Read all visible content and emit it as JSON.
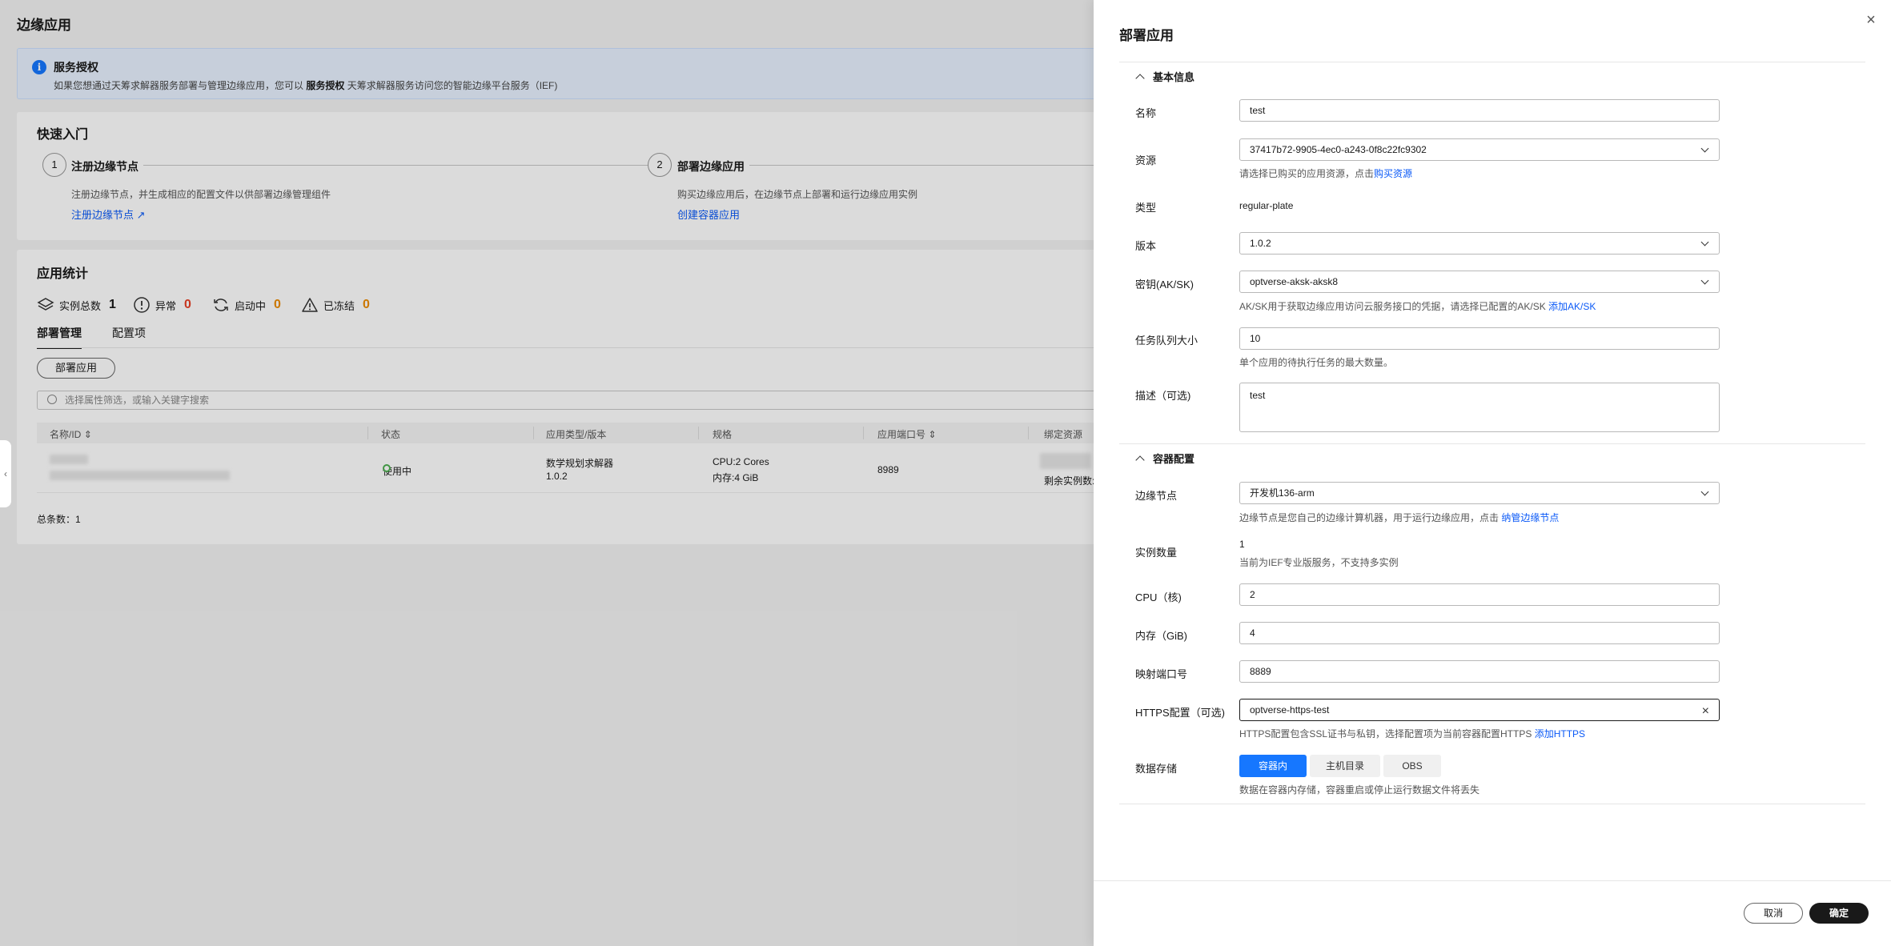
{
  "page": {
    "title": "边缘应用",
    "auth": {
      "title": "服务授权",
      "desc_pre": "如果您想通过天筹求解器服务部署与管理边缘应用，您可以",
      "desc_bold": "服务授权",
      "desc_post": "天筹求解器服务访问您的智能边缘平台服务（IEF)"
    },
    "quick": {
      "title": "快速入门",
      "steps": [
        {
          "num": "1",
          "title": "注册边缘节点",
          "desc": "注册边缘节点，并生成相应的配置文件以供部署边缘管理组件",
          "link": "注册边缘节点"
        },
        {
          "num": "2",
          "title": "部署边缘应用",
          "desc": "购买边缘应用后，在边缘节点上部署和运行边缘应用实例",
          "link": "创建容器应用"
        }
      ]
    },
    "stats": {
      "title": "应用统计",
      "items": [
        {
          "label": "实例总数",
          "value": "1"
        },
        {
          "label": "异常",
          "value": "0"
        },
        {
          "label": "启动中",
          "value": "0"
        },
        {
          "label": "已冻结",
          "value": "0"
        }
      ]
    },
    "tabs": [
      "部署管理",
      "配置项"
    ],
    "deploy_button": "部署应用",
    "search_placeholder": "选择属性筛选，或输入关键字搜索",
    "table": {
      "headers": [
        "名称/ID",
        "状态",
        "应用类型/版本",
        "规格",
        "应用端口号",
        "绑定资源"
      ],
      "row": {
        "status": "使用中",
        "type": "数学规划求解器",
        "version": "1.0.2",
        "cpu": "CPU:2 Cores",
        "mem": "内存:4 GiB",
        "port": "8989",
        "resource": "剩余实例数:"
      },
      "total": "总条数：1"
    }
  },
  "drawer": {
    "title": "部署应用",
    "basic_section": "基本信息",
    "container_section": "容器配置",
    "fields": {
      "name": {
        "label": "名称",
        "value": "test"
      },
      "resource": {
        "label": "资源",
        "value": "37417b72-9905-4ec0-a243-0f8c22fc9302",
        "hint": "请选择已购买的应用资源，点击",
        "hint_link": "购买资源"
      },
      "type": {
        "label": "类型",
        "value": "regular-plate"
      },
      "version": {
        "label": "版本",
        "value": "1.0.2"
      },
      "secret": {
        "label": "密钥(AK/SK)",
        "value": "optverse-aksk-aksk8",
        "hint": "AK/SK用于获取边缘应用访问云服务接口的凭据，请选择已配置的AK/SK",
        "hint_link": "添加AK/SK"
      },
      "queue": {
        "label": "任务队列大小",
        "value": "10",
        "hint": "单个应用的待执行任务的最大数量。"
      },
      "desc": {
        "label": "描述（可选)",
        "value": "test"
      },
      "node": {
        "label": "边缘节点",
        "value": "开发机136-arm",
        "hint": "边缘节点是您自己的边缘计算机器，用于运行边缘应用，点击",
        "hint_link": "纳管边缘节点"
      },
      "instances": {
        "label": "实例数量",
        "value": "1",
        "hint": "当前为IEF专业版服务，不支持多实例"
      },
      "cpu": {
        "label": "CPU（核)",
        "value": "2"
      },
      "memory": {
        "label": "内存（GiB)",
        "value": "4"
      },
      "port": {
        "label": "映射端口号",
        "value": "8889"
      },
      "https": {
        "label": "HTTPS配置（可选)",
        "value": "optverse-https-test",
        "hint": "HTTPS配置包含SSL证书与私钥，选择配置项为当前容器配置HTTPS",
        "hint_link": "添加HTTPS"
      },
      "storage": {
        "label": "数据存储",
        "options": [
          "容器内",
          "主机目录",
          "OBS"
        ],
        "selected": "容器内",
        "hint": "数据在容器内存储，容器重启或停止运行数据文件将丢失"
      }
    },
    "cancel": "取消",
    "confirm": "确定"
  },
  "colors": {
    "accent": "#1677ff",
    "link": "#0a59f7",
    "danger": "#e84026",
    "warning": "#ed8b00",
    "primary_button": "#191919"
  }
}
